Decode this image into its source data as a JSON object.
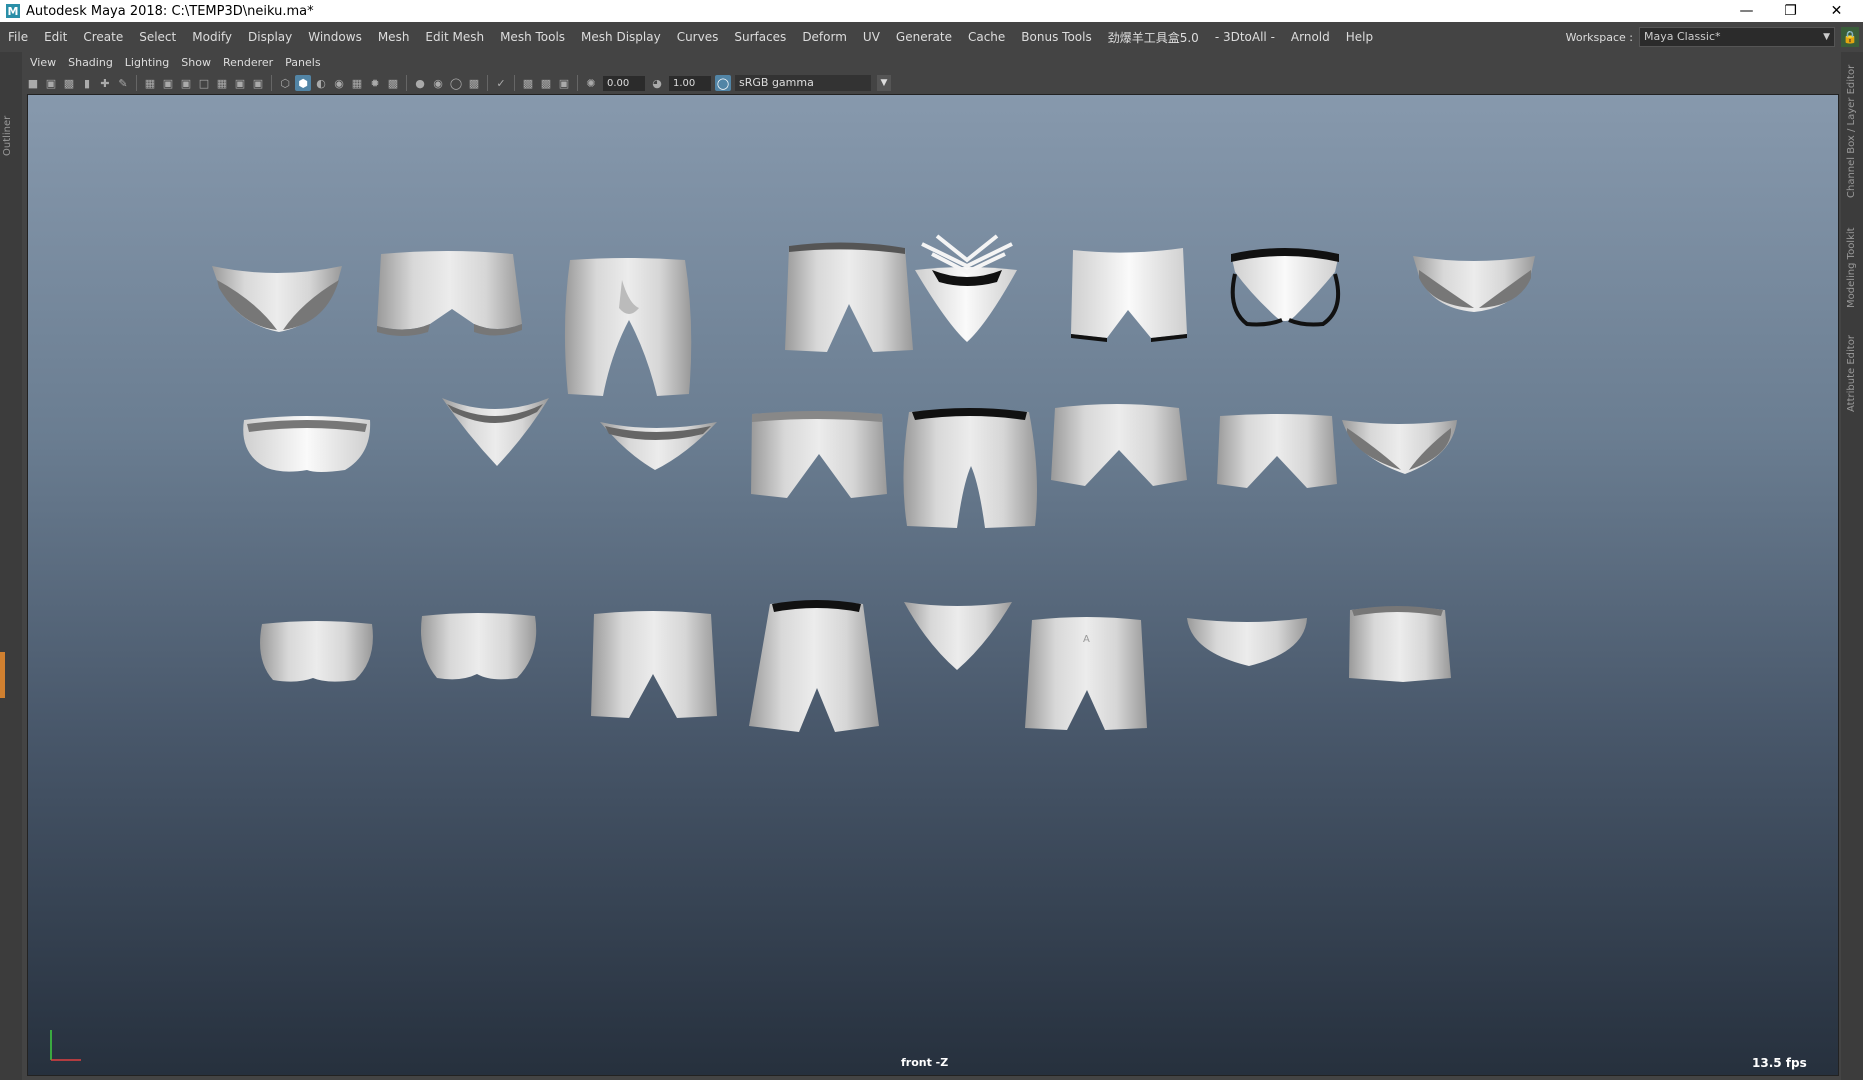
{
  "window": {
    "title": "Autodesk Maya 2018: C:\\TEMP3D\\neiku.ma*",
    "logo_letter": "M",
    "controls": [
      "minimize",
      "restore",
      "close"
    ]
  },
  "menubar": {
    "items": [
      "File",
      "Edit",
      "Create",
      "Select",
      "Modify",
      "Display",
      "Windows",
      "Mesh",
      "Edit Mesh",
      "Mesh Tools",
      "Mesh Display",
      "Curves",
      "Surfaces",
      "Deform",
      "UV",
      "Generate",
      "Cache",
      "Bonus Tools",
      "劲爆羊工具盒5.0",
      "- 3DtoAll -",
      "Arnold",
      "Help"
    ],
    "workspace_label": "Workspace :",
    "workspace_value": "Maya Classic*"
  },
  "left_panel": {
    "label": "Outliner"
  },
  "right_panel": {
    "labels": [
      "Channel Box / Layer Editor",
      "Modeling Toolkit",
      "Attribute Editor"
    ]
  },
  "panel_menu": {
    "items": [
      "View",
      "Shading",
      "Lighting",
      "Show",
      "Renderer",
      "Panels"
    ]
  },
  "toolbar": {
    "exposure_value": "0.00",
    "gamma_value": "1.00",
    "color_space": "sRGB gamma"
  },
  "viewport": {
    "camera_label": "front -Z",
    "fps": "13.5 fps",
    "axis_colors": {
      "x": "#e04040",
      "y": "#40d040"
    },
    "objects_count": 24
  },
  "colors": {
    "mesh_fill": "#d4d4d4",
    "mesh_shadow": "#7a7a7a",
    "viewport_top": "#8799ad",
    "viewport_bottom": "#26303d"
  }
}
